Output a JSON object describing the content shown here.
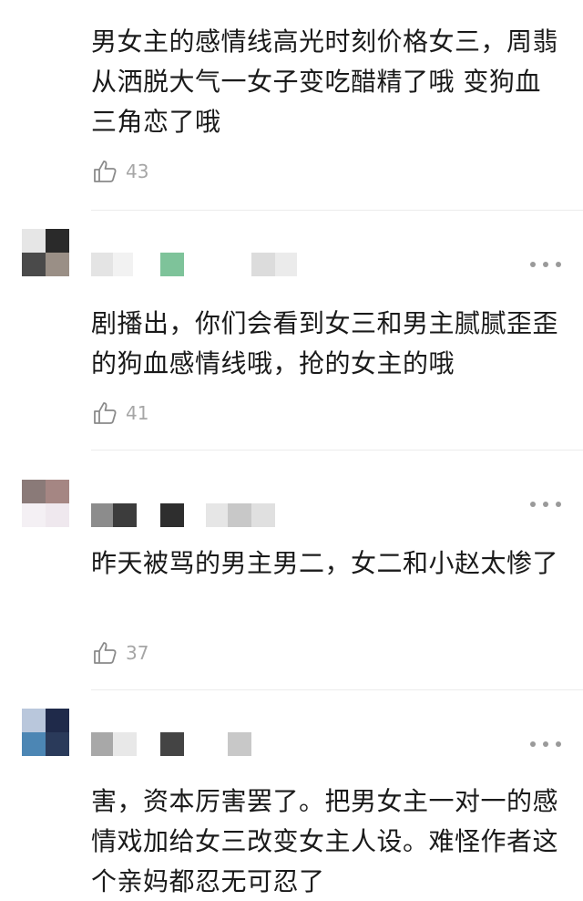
{
  "comments": [
    {
      "text": "男女主的感情线高光时刻价格女三，周翡从洒脱大气一女子变吃醋精了哦 变狗血三角恋了哦",
      "likes": "43"
    },
    {
      "text": "剧播出，你们会看到女三和男主腻腻歪歪的狗血感情线哦，抢的女主的哦",
      "likes": "41"
    },
    {
      "text": "昨天被骂的男主男二，女二和小赵太惨了",
      "likes": "37"
    },
    {
      "text": "害，资本厉害罢了。把男女主一对一的感情戏加给女三改变女主人设。难怪作者这个亲妈都忍无可忍了",
      "likes": ""
    }
  ],
  "icons": {
    "like": "thumbs-up-icon",
    "more": "more-dots-icon",
    "avatar": "blurred-avatar"
  },
  "colors": {
    "text": "#1a1a1a",
    "muted": "#a6a6a6",
    "divider": "#ececec"
  }
}
